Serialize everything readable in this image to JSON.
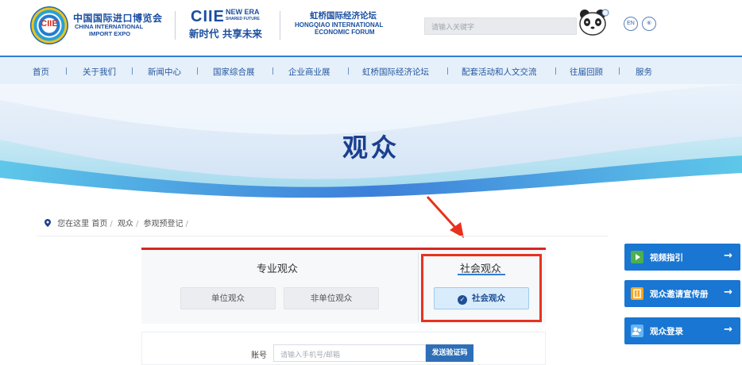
{
  "header": {
    "logo_text": "CIIE",
    "logo_cn": "中国国际进口博览会",
    "logo_en_line1": "CHINA INTERNATIONAL",
    "logo_en_line2": "IMPORT EXPO",
    "brand": "CIIE",
    "brand_newera": "NEW ERA",
    "brand_shared": "SHARED FUTURE",
    "brand_slogan": "新时代 共享未来",
    "forum_cn": "虹桥国际经济论坛",
    "forum_en_line1": "HONGQIAO INTERNATIONAL",
    "forum_en_line2": "ECONOMIC FORUM",
    "search_placeholder": "请输入关键字",
    "lang_en": "EN",
    "lang_other": "⑥"
  },
  "nav": {
    "items": [
      "首页",
      "关于我们",
      "新闻中心",
      "国家综合展",
      "企业商业展",
      "虹桥国际经济论坛",
      "配套活动和人文交流",
      "往届回顾",
      "服务"
    ]
  },
  "banner": {
    "title": "观众"
  },
  "breadcrumb": {
    "prefix": "您在这里",
    "items": [
      "首页",
      "观众",
      "参观预登记"
    ]
  },
  "registration": {
    "professional_title": "专业观众",
    "public_title": "社会观众",
    "btn_unit": "单位观众",
    "btn_non_unit": "非单位观众",
    "btn_public": "社会观众",
    "account_label": "账号",
    "account_placeholder": "请输入手机号/邮箱",
    "send_code": "发送验证码"
  },
  "sidebar": {
    "buttons": [
      {
        "label": "视频指引",
        "icon": "video-icon",
        "color": "#4caf50"
      },
      {
        "label": "观众邀请宣传册",
        "icon": "brochure-icon",
        "color": "#f5a623"
      },
      {
        "label": "观众登录",
        "icon": "user-login-icon",
        "color": "#64b5f6"
      }
    ]
  },
  "colors": {
    "primary_blue": "#1976d2",
    "annotation_red": "#e8321f",
    "nav_bg": "#e6f0fa"
  }
}
